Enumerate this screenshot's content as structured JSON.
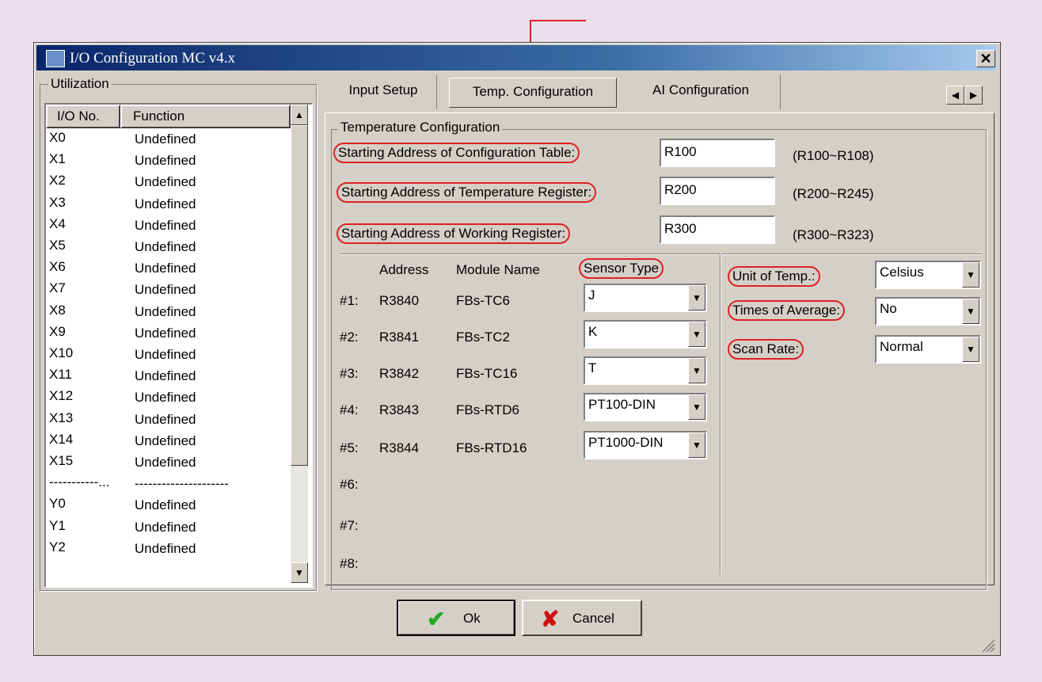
{
  "window": {
    "title": "I/O Configuration MC v4.x"
  },
  "utilization": {
    "label": "Utilization",
    "headers": [
      "I/O No.",
      "Function"
    ],
    "rows": [
      [
        "X0",
        "Undefined"
      ],
      [
        "X1",
        "Undefined"
      ],
      [
        "X2",
        "Undefined"
      ],
      [
        "X3",
        "Undefined"
      ],
      [
        "X4",
        "Undefined"
      ],
      [
        "X5",
        "Undefined"
      ],
      [
        "X6",
        "Undefined"
      ],
      [
        "X7",
        "Undefined"
      ],
      [
        "X8",
        "Undefined"
      ],
      [
        "X9",
        "Undefined"
      ],
      [
        "X10",
        "Undefined"
      ],
      [
        "X11",
        "Undefined"
      ],
      [
        "X12",
        "Undefined"
      ],
      [
        "X13",
        "Undefined"
      ],
      [
        "X14",
        "Undefined"
      ],
      [
        "X15",
        "Undefined"
      ],
      [
        "-----------...",
        "---------------------"
      ],
      [
        "Y0",
        "Undefined"
      ],
      [
        "Y1",
        "Undefined"
      ],
      [
        "Y2",
        "Undefined"
      ]
    ]
  },
  "tabs": [
    "Input Setup",
    "Temp. Configuration",
    "AI Configuration"
  ],
  "temp": {
    "label": "Temperature Configuration",
    "rows": [
      {
        "label": "Starting Address of Configuration Table:",
        "value": "R100",
        "range": "(R100~R108)"
      },
      {
        "label": "Starting Address of Temperature Register:",
        "value": "R200",
        "range": "(R200~R245)"
      },
      {
        "label": "Starting Address of Working Register:",
        "value": "R300",
        "range": "(R300~R323)"
      }
    ],
    "col_headers": {
      "address": "Address",
      "module": "Module Name",
      "sensor": "Sensor Type"
    },
    "modules": [
      {
        "num": "#1:",
        "address": "R3840",
        "name": "FBs-TC6",
        "sensor": "J"
      },
      {
        "num": "#2:",
        "address": "R3841",
        "name": "FBs-TC2",
        "sensor": "K"
      },
      {
        "num": "#3:",
        "address": "R3842",
        "name": "FBs-TC16",
        "sensor": "T"
      },
      {
        "num": "#4:",
        "address": "R3843",
        "name": "FBs-RTD6",
        "sensor": "PT100-DIN"
      },
      {
        "num": "#5:",
        "address": "R3844",
        "name": "FBs-RTD16",
        "sensor": "PT1000-DIN"
      },
      {
        "num": "#6:"
      },
      {
        "num": "#7:"
      },
      {
        "num": "#8:"
      }
    ],
    "settings": [
      {
        "label": "Unit of Temp.:",
        "value": "Celsius"
      },
      {
        "label": "Times of Average:",
        "value": "No"
      },
      {
        "label": "Scan Rate:",
        "value": "Normal"
      }
    ]
  },
  "buttons": {
    "ok": "Ok",
    "cancel": "Cancel"
  },
  "colors": {
    "annotation": "#dd2222",
    "ok_icon": "#22aa22",
    "cancel_icon": "#cc1111",
    "title_bar": "#0a246a"
  }
}
